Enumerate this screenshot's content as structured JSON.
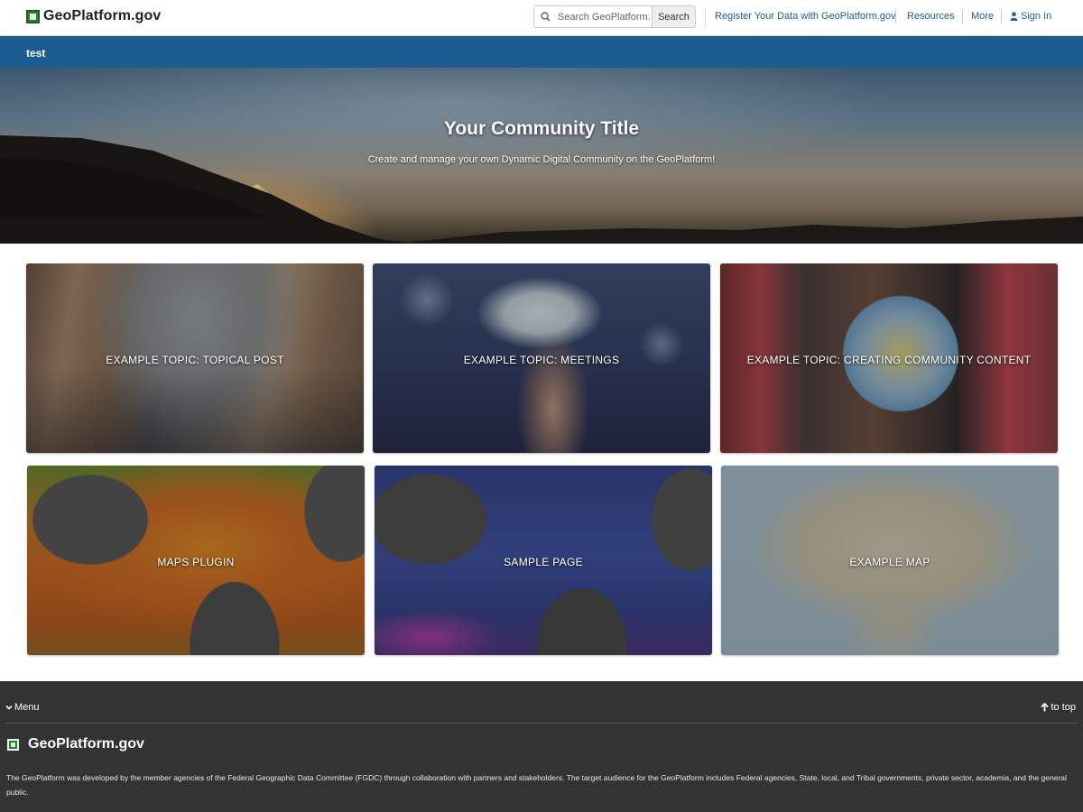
{
  "header": {
    "brand": "GeoPlatform.gov",
    "search": {
      "placeholder": "Search GeoPlatform...",
      "button": "Search"
    },
    "nav": {
      "register": "Register Your Data with GeoPlatform.gov",
      "resources": "Resources",
      "more": "More",
      "sign_in": "Sign In"
    }
  },
  "bluebar": {
    "label": "test"
  },
  "hero": {
    "title": "Your Community Title",
    "subtitle": "Create and manage your own Dynamic Digital Community on the GeoPlatform!"
  },
  "cards": [
    {
      "label": "EXAMPLE TOPIC: TOPICAL POST"
    },
    {
      "label": "EXAMPLE TOPIC: MEETINGS"
    },
    {
      "label": "EXAMPLE TOPIC: CREATING COMMUNITY CONTENT"
    },
    {
      "label": "MAPS PLUGIN"
    },
    {
      "label": "SAMPLE PAGE"
    },
    {
      "label": "EXAMPLE MAP"
    }
  ],
  "footer": {
    "menu": "Menu",
    "to_top": "to top",
    "brand": "GeoPlatform.gov",
    "description": "The GeoPlatform was developed by the member agencies of the Federal Geographic Data Committee (FGDC) through collaboration with partners and stakeholders. The target audience for the GeoPlatform includes Federal agencies, State, local, and Tribal governments, private sector, academia, and the general public."
  },
  "colors": {
    "bluebar": "#1c5d91",
    "link": "#1f5d98",
    "footer": "#333333",
    "brand_green": "#2e7d32"
  },
  "icons": [
    "search-icon",
    "user-icon",
    "chevron-down-icon",
    "arrow-up-icon",
    "geoplatform-logo-icon"
  ]
}
